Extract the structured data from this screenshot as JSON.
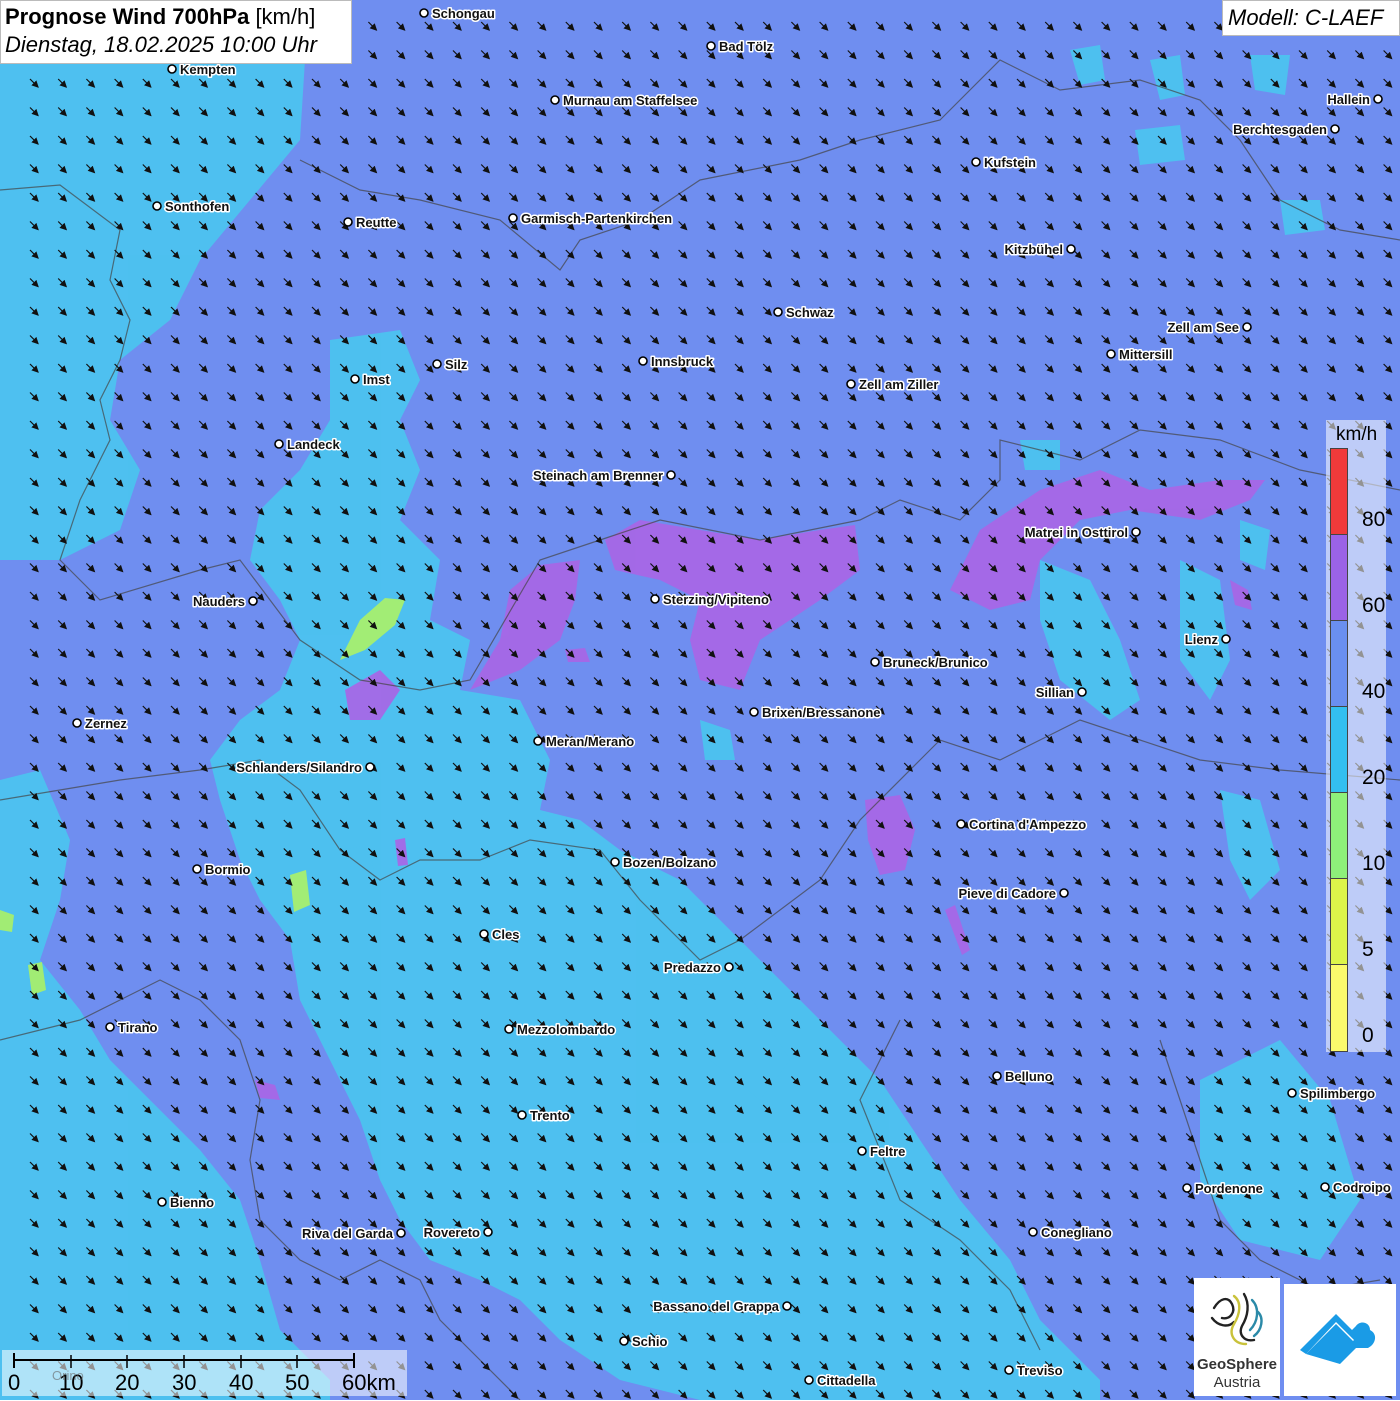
{
  "header": {
    "title": "Prognose Wind 700hPa",
    "unit": "[km/h]",
    "datetime": "Dienstag, 18.02.2025 10:00 Uhr"
  },
  "model": "Modell: C-LAEF",
  "legend": {
    "unit": "km/h",
    "ticks": [
      "80",
      "60",
      "40",
      "20",
      "10",
      "5",
      "0"
    ],
    "colors": [
      "#f03a3a",
      "#9b63e6",
      "#6a8ff0",
      "#33bff0",
      "#8ef07a",
      "#ddf54a",
      "#fbfa6c",
      "#cfe8ff"
    ]
  },
  "scale_bar": {
    "labels": [
      "0",
      "10",
      "20",
      "30",
      "40",
      "50",
      "60km"
    ],
    "faint_label": "Orino"
  },
  "logos": {
    "geosphere_line1": "GeoSphere",
    "geosphere_line2": "Austria"
  },
  "cities": [
    "Schongau",
    "Bad Tölz",
    "Kempten",
    "Murnau am Staffelsee",
    "Hallein",
    "Berchtesgaden",
    "Kufstein",
    "Sonthofen",
    "Reutte",
    "Garmisch-Partenkirchen",
    "Kitzbühel",
    "Schwaz",
    "Zell am See",
    "Mittersill",
    "Innsbruck",
    "Silz",
    "Imst",
    "Zell am Ziller",
    "Landeck",
    "Steinach am Brenner",
    "Matrei in Osttirol",
    "Nauders",
    "Sterzing/Vipiteno",
    "Lienz",
    "Bruneck/Brunico",
    "Sillian",
    "Zernez",
    "Brixen/Bressanone",
    "Meran/Merano",
    "Schlanders/Silandro",
    "Cortina d'Ampezzo",
    "Bozen/Bolzano",
    "Bormio",
    "Pieve di Cadore",
    "Cles",
    "Predazzo",
    "Tirano",
    "Mezzolombardo",
    "Belluno",
    "Spilimbergo",
    "Trento",
    "Feltre",
    "Bienno",
    "Pordenone",
    "Codroipo",
    "Riva del Garda",
    "Rovereto",
    "Conegliano",
    "Bassano del Grappa",
    "Schio",
    "Treviso",
    "Cittadella"
  ]
}
